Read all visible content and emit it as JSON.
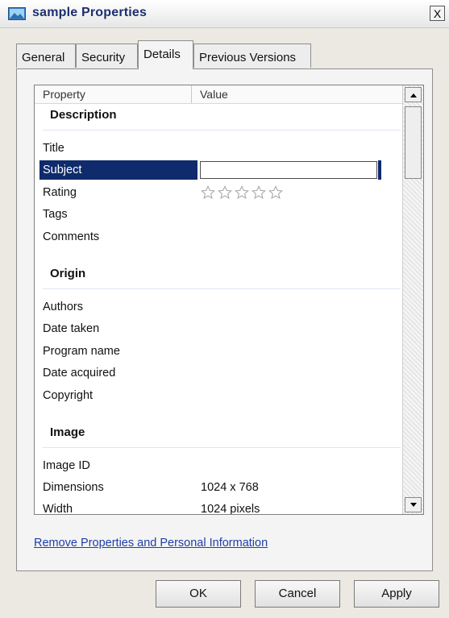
{
  "window": {
    "title": "sample Properties",
    "close_label": "X"
  },
  "tabs": [
    {
      "label": "General"
    },
    {
      "label": "Security"
    },
    {
      "label": "Details"
    },
    {
      "label": "Previous Versions"
    }
  ],
  "active_tab": "Details",
  "list": {
    "headers": {
      "property": "Property",
      "value": "Value"
    },
    "groups": [
      {
        "name": "Description",
        "rows": [
          {
            "label": "Title",
            "value": ""
          },
          {
            "label": "Subject",
            "value": ""
          },
          {
            "label": "Rating",
            "value": ""
          },
          {
            "label": "Tags",
            "value": ""
          },
          {
            "label": "Comments",
            "value": ""
          }
        ]
      },
      {
        "name": "Origin",
        "rows": [
          {
            "label": "Authors",
            "value": ""
          },
          {
            "label": "Date taken",
            "value": ""
          },
          {
            "label": "Program name",
            "value": ""
          },
          {
            "label": "Date acquired",
            "value": ""
          },
          {
            "label": "Copyright",
            "value": ""
          }
        ]
      },
      {
        "name": "Image",
        "rows": [
          {
            "label": "Image ID",
            "value": ""
          },
          {
            "label": "Dimensions",
            "value": "1024 x 768"
          },
          {
            "label": "Width",
            "value": "1024 pixels"
          }
        ]
      }
    ],
    "selected_row": "Subject",
    "rating": {
      "stars_filled": 0,
      "stars_total": 5
    }
  },
  "links": {
    "remove_properties": "Remove Properties and Personal Information"
  },
  "buttons": {
    "ok": "OK",
    "cancel": "Cancel",
    "apply": "Apply"
  },
  "colors": {
    "selection": "#0f2b6b",
    "link": "#1d3ea8",
    "title_text": "#1b2f6e"
  },
  "icons": {
    "window": "picture-file-icon",
    "scroll_up": "arrow-up-icon",
    "scroll_down": "arrow-down-icon",
    "star": "star-outline-icon"
  }
}
